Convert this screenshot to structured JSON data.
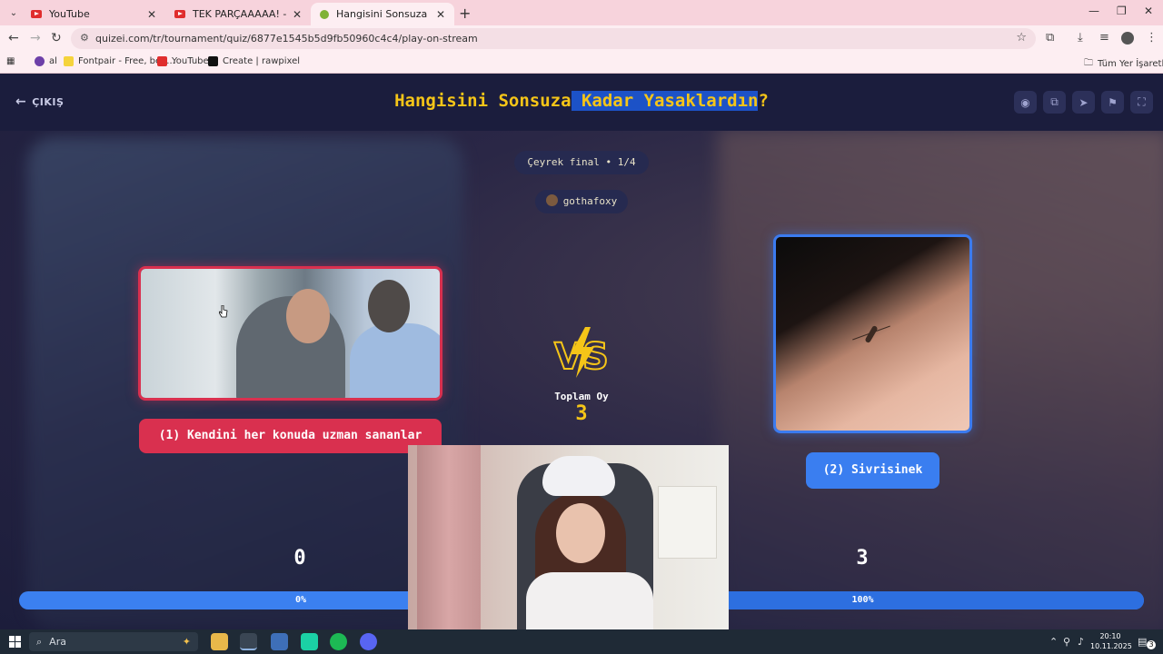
{
  "browser": {
    "tabs": [
      {
        "label": "YouTube",
        "active": false
      },
      {
        "label": "TEK PARÇAAAAA! - YouTube",
        "active": false
      },
      {
        "label": "Hangisini Sonsuza Kadar Yasakla",
        "active": true
      }
    ],
    "url": "quizei.com/tr/tournament/quiz/6877e1545b5d9fb50960c4c4/play-on-stream",
    "bookmarks": [
      {
        "label": "al"
      },
      {
        "label": "Fontpair - Free, bea..."
      },
      {
        "label": "YouTube"
      },
      {
        "label": "Create | rawpixel"
      }
    ],
    "bookmarks_folder": "Tüm Yer İşaretleri"
  },
  "app": {
    "exit_label": "ÇIKIŞ",
    "title_part1": "Hangisini Sonsuza",
    "title_highlight": " Kadar Yasaklardın",
    "title_part2": "?",
    "round_label": "Çeyrek final • 1/4",
    "streamer": "gothafoxy",
    "left_option": {
      "label": "(1) Kendini her konuda uzman sananlar",
      "score": "0",
      "percent_label": "0%",
      "percent": 0
    },
    "right_option": {
      "label": "(2) Sivrisinek",
      "score": "3",
      "percent_label": "100%",
      "percent": 100
    },
    "vs_text": "VS",
    "total_votes_label": "Toplam Oy",
    "total_votes": "3",
    "colors": {
      "title": "#f5c518",
      "left_accent": "#d9304f",
      "right_accent": "#3a7ef0",
      "highlight": "#1c52c7"
    }
  },
  "taskbar": {
    "search_placeholder": "Ara",
    "time": "20:10",
    "date": "10.11.2025",
    "notification_count": "3"
  }
}
